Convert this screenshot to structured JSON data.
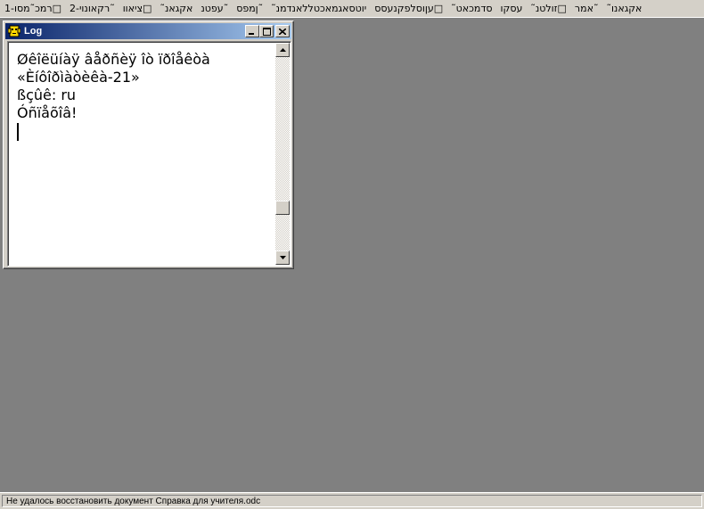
{
  "menubar": {
    "items": [
      {
        "label": "1-רמכ˜מסו□"
      },
      {
        "label": "2-רקאונוי˜"
      },
      {
        "label": "ציאוו□"
      },
      {
        "label": "˜אקגאנ"
      },
      {
        "label": "עפטנ˜"
      },
      {
        "label": "ןמפס˜"
      },
      {
        "label": "˜יוטסאגמאכטללאנדמנ"
      },
      {
        "label": "עןוסלפקנעסס□"
      },
      {
        "label": "˜סדמכאט"
      },
      {
        "label": "עסקו"
      },
      {
        "label": "˜זולטנ□"
      },
      {
        "label": "אמר˜"
      },
      {
        "label": "˜אקגאנו"
      }
    ]
  },
  "log_window": {
    "title": "Log",
    "icons": {
      "app": "app-icon",
      "minimize": "minimize-icon",
      "maximize": "maximize-icon",
      "close": "close-icon"
    },
    "lines": [
      "Øêîëüíàÿ âåðñèÿ îò ïðîåêòà",
      "«Èíôîðìàòèêà-21»",
      "ßçûê: ru",
      "Óñïåõîâ!"
    ]
  },
  "statusbar": {
    "text": "Не удалось восстановить документ Справка для учителя.odc"
  }
}
